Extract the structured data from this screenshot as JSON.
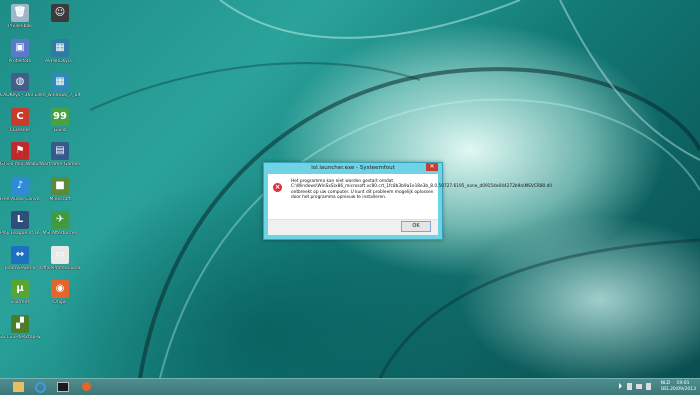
{
  "desktop": {
    "icons": [
      {
        "label": "Prullenbak",
        "color": "#9fb6c8",
        "glyph": "🗑"
      },
      {
        "label": "",
        "color": "#3b3b3b",
        "glyph": "☺"
      },
      {
        "label": "Profielfoto",
        "color": "#5b79c9",
        "glyph": "▣"
      },
      {
        "label": "AVPaRDkyu...",
        "color": "#2e7ca3",
        "glyph": "▦"
      },
      {
        "label": "CADKeys - 360 Electrical sch...",
        "color": "#425f8a",
        "glyph": "◍"
      },
      {
        "label": "en_windows_7_ultim...",
        "color": "#2f8ab5",
        "glyph": "▦"
      },
      {
        "label": "CCleaner",
        "color": "#c93b2b",
        "glyph": "C"
      },
      {
        "label": "Giuliz",
        "color": "#48a142",
        "glyph": "99"
      },
      {
        "label": "GTS-0 mini Wallpaper...",
        "color": "#c12a2a",
        "glyph": "⚑"
      },
      {
        "label": "Warframe-Gamen...",
        "color": "#355a8c",
        "glyph": "▤"
      },
      {
        "label": "Free Audio Converter",
        "color": "#2f8bd6",
        "glyph": "♪"
      },
      {
        "label": "Minecraft",
        "color": "#5a8b3a",
        "glyph": "■"
      },
      {
        "label": "Play League of Legends",
        "color": "#2d4f7a",
        "glyph": "L"
      },
      {
        "label": "MSI Afterburner",
        "color": "#3f9a40",
        "glyph": "✈"
      },
      {
        "label": "TeamViewer 8",
        "color": "#1f6fc1",
        "glyph": "↔"
      },
      {
        "label": "OfficeProfessional...",
        "color": "#e8e8e8",
        "glyph": "▭"
      },
      {
        "label": "uTorrent",
        "color": "#58a631",
        "glyph": "μ"
      },
      {
        "label": "Origin",
        "color": "#e4652a",
        "glyph": "◉"
      },
      {
        "label": "327.23-desktop-w...",
        "color": "#4b7d2a",
        "glyph": "▞"
      }
    ]
  },
  "dialog": {
    "title": "lol.launcher.exe - Systeemfout",
    "close_label": "✕",
    "error_icon": "error-x-icon",
    "message": "Het programma kan niet worden gestart omdat C:\\Windows\\WinSxS\\x86_microsoft.vc80.crt_1fc8b3b9a1e18e3b_8.0.50727.6195_none_d09154e044272b9a\\MSVCR80.dll ontbreekt op uw computer. U kunt dit probleem mogelijk oplossen door het programma opnieuw te installeren.",
    "ok_label": "OK"
  },
  "taskbar": {
    "buttons": [
      {
        "name": "file-explorer",
        "color": "#e8c062"
      },
      {
        "name": "internet-explorer",
        "color": "#3c9be0"
      },
      {
        "name": "command-prompt",
        "color": "#1a1a1a"
      },
      {
        "name": "origin",
        "color": "#e4652a"
      }
    ],
    "language_top": "NLD",
    "language_bottom": "BEL",
    "time": "19:01",
    "date": "20/09/2013"
  },
  "colors": {
    "accent": "#6fd3e6",
    "error": "#d13438",
    "taskbar": "#4a8688"
  }
}
